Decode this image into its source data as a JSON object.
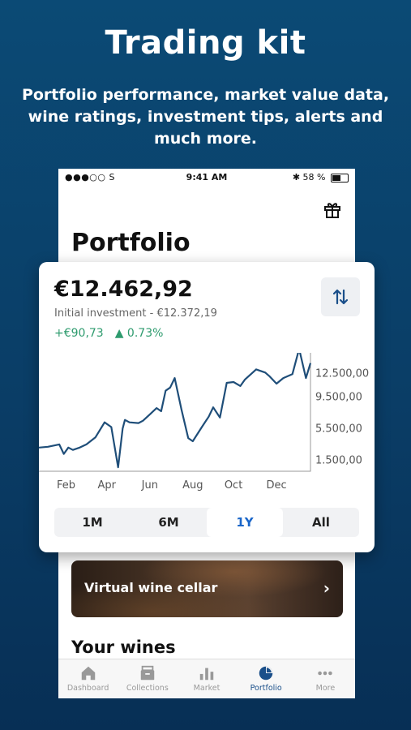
{
  "hero": {
    "title": "Trading kit",
    "subtitle": "Portfolio performance, market value data, wine ratings, investment tips, alerts and much more."
  },
  "status_bar": {
    "carrier": "●●●○○ S",
    "time": "9:41 AM",
    "battery": "58 %",
    "battery_level": 0.58
  },
  "page": {
    "title": "Portfolio"
  },
  "portfolio": {
    "value": "€12.462,92",
    "initial_investment": "Initial investment - €12.372,19",
    "change_abs": "+€90,73",
    "change_pct": "▲ 0.73%"
  },
  "chart_data": {
    "type": "line",
    "x_tick_labels": [
      "Feb",
      "Apr",
      "Jun",
      "Aug",
      "Oct",
      "Dec"
    ],
    "y_tick_labels": [
      "12.500,00",
      "9.500,00",
      "5.500,00",
      "1.500,00"
    ],
    "y_ticks": [
      12500,
      9500,
      5500,
      1500
    ],
    "xlim": [
      0,
      12
    ],
    "ylim": [
      0,
      15000
    ],
    "series": [
      {
        "color": "#1f4e79",
        "x": [
          0,
          0.4,
          0.9,
          1.1,
          1.3,
          1.5,
          1.8,
          2.1,
          2.5,
          2.9,
          3.2,
          3.5,
          3.7,
          3.8,
          4.0,
          4.4,
          4.6,
          4.9,
          5.2,
          5.4,
          5.6,
          5.8,
          6.0,
          6.3,
          6.6,
          6.8,
          7.2,
          7.5,
          7.7,
          8.0,
          8.3,
          8.6,
          8.9,
          9.1,
          9.6,
          10.0,
          10.2,
          10.5,
          10.8,
          11.2,
          11.5,
          11.8,
          12.0
        ],
        "y": [
          3000,
          3100,
          3400,
          2200,
          3000,
          2700,
          3000,
          3400,
          4300,
          6200,
          5600,
          500,
          5400,
          6500,
          6200,
          6100,
          6400,
          7200,
          8000,
          7600,
          10200,
          10600,
          11800,
          7800,
          4200,
          3800,
          5600,
          6900,
          8100,
          6800,
          11200,
          11300,
          10800,
          11600,
          12900,
          12500,
          12000,
          11100,
          11800,
          12300,
          15500,
          11800,
          13700
        ]
      }
    ]
  },
  "periods": [
    "1M",
    "6M",
    "1Y",
    "All"
  ],
  "active_period": "1Y",
  "cellar": {
    "label": "Virtual wine cellar"
  },
  "your_wines": {
    "title": "Your wines"
  },
  "tabs": [
    {
      "label": "Dashboard",
      "icon": "home-icon"
    },
    {
      "label": "Collections",
      "icon": "collections-icon"
    },
    {
      "label": "Market",
      "icon": "market-icon"
    },
    {
      "label": "Portfolio",
      "icon": "portfolio-icon"
    },
    {
      "label": "More",
      "icon": "more-icon"
    }
  ],
  "active_tab": "Portfolio",
  "colors": {
    "background": "#0b4a75",
    "accent_blue": "#1a66c9",
    "positive_green": "#2e9b6e",
    "chart_line": "#1f4e79",
    "tab_active": "#1a4f8a"
  }
}
